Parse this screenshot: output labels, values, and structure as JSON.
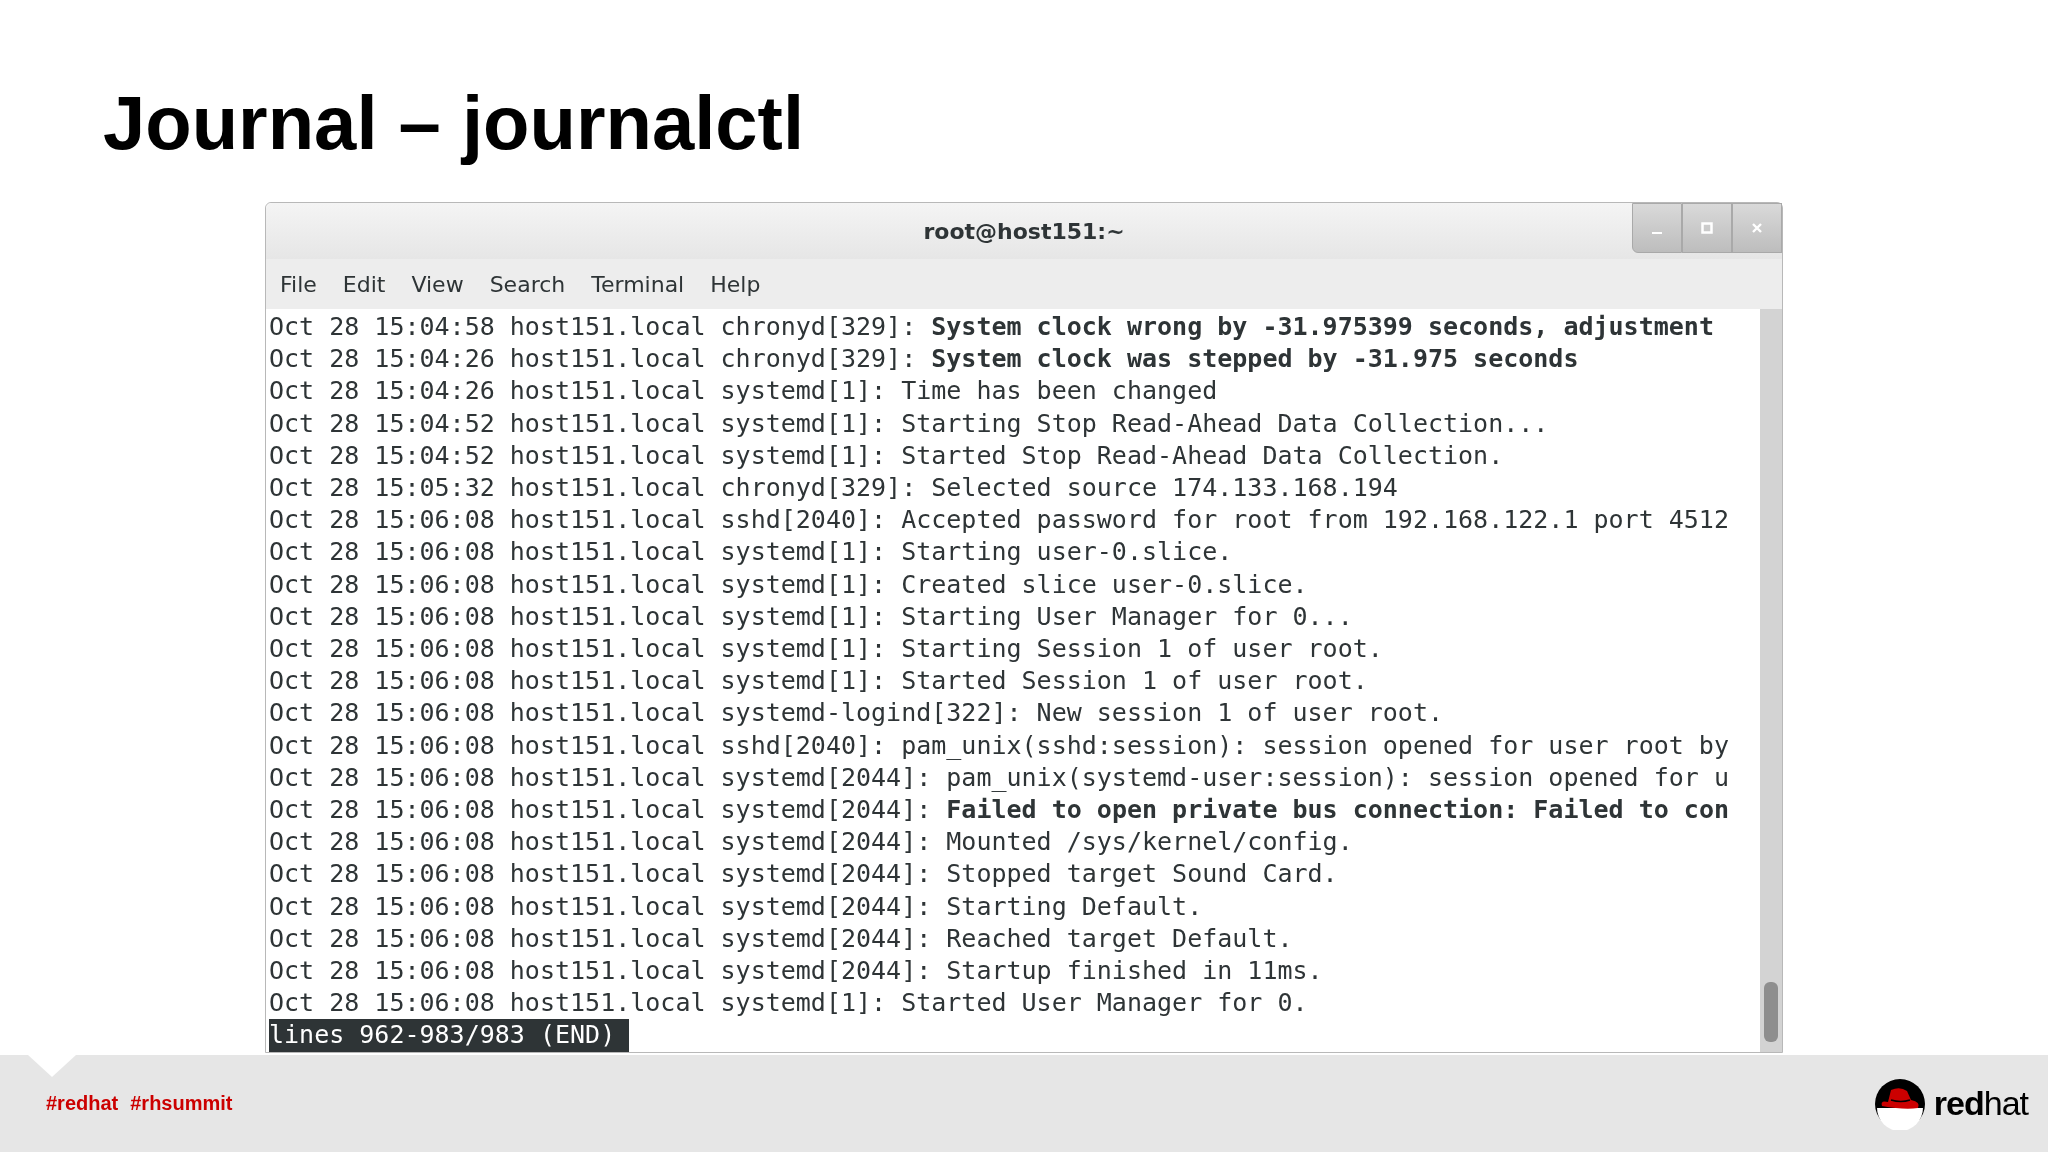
{
  "slide_title": "Journal – journalctl",
  "window": {
    "title": "root@host151:~"
  },
  "menu": [
    "File",
    "Edit",
    "View",
    "Search",
    "Terminal",
    "Help"
  ],
  "log_lines": [
    "Oct 28 15:04:58 host151.local chronyd[329]: **System clock wrong by -31.975399 seconds, adjustment**",
    "Oct 28 15:04:26 host151.local chronyd[329]: **System clock was stepped by -31.975 seconds**",
    "Oct 28 15:04:26 host151.local systemd[1]: Time has been changed",
    "Oct 28 15:04:52 host151.local systemd[1]: Starting Stop Read-Ahead Data Collection...",
    "Oct 28 15:04:52 host151.local systemd[1]: Started Stop Read-Ahead Data Collection.",
    "Oct 28 15:05:32 host151.local chronyd[329]: Selected source 174.133.168.194",
    "Oct 28 15:06:08 host151.local sshd[2040]: Accepted password for root from 192.168.122.1 port 4512",
    "Oct 28 15:06:08 host151.local systemd[1]: Starting user-0.slice.",
    "Oct 28 15:06:08 host151.local systemd[1]: Created slice user-0.slice.",
    "Oct 28 15:06:08 host151.local systemd[1]: Starting User Manager for 0...",
    "Oct 28 15:06:08 host151.local systemd[1]: Starting Session 1 of user root.",
    "Oct 28 15:06:08 host151.local systemd[1]: Started Session 1 of user root.",
    "Oct 28 15:06:08 host151.local systemd-logind[322]: New session 1 of user root.",
    "Oct 28 15:06:08 host151.local sshd[2040]: pam_unix(sshd:session): session opened for user root by",
    "Oct 28 15:06:08 host151.local systemd[2044]: pam_unix(systemd-user:session): session opened for u",
    "Oct 28 15:06:08 host151.local systemd[2044]: **Failed to open private bus connection: Failed to con**",
    "Oct 28 15:06:08 host151.local systemd[2044]: Mounted /sys/kernel/config.",
    "Oct 28 15:06:08 host151.local systemd[2044]: Stopped target Sound Card.",
    "Oct 28 15:06:08 host151.local systemd[2044]: Starting Default.",
    "Oct 28 15:06:08 host151.local systemd[2044]: Reached target Default.",
    "Oct 28 15:06:08 host151.local systemd[2044]: Startup finished in 11ms.",
    "Oct 28 15:06:08 host151.local systemd[1]: Started User Manager for 0."
  ],
  "pager_status": "lines 962-983/983 (END)",
  "footer": {
    "hashtags": [
      "#redhat",
      "#rhsummit"
    ],
    "logo_text": "**red**hat"
  }
}
